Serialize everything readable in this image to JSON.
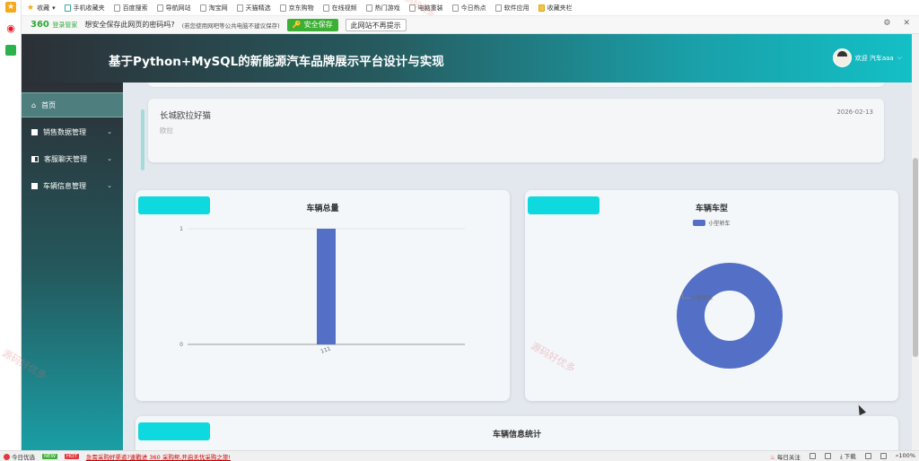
{
  "browser": {
    "bookmarks": [
      {
        "label": "收藏",
        "icon": "star-icon"
      },
      {
        "label": "手机收藏夹",
        "icon": "phone-icon"
      },
      {
        "label": "百度搜索",
        "icon": "page-icon"
      },
      {
        "label": "导航网站",
        "icon": "page-icon"
      },
      {
        "label": "淘宝网",
        "icon": "page-icon"
      },
      {
        "label": "天猫精选",
        "icon": "page-icon"
      },
      {
        "label": "京东购物",
        "icon": "page-icon"
      },
      {
        "label": "在线视频",
        "icon": "page-icon"
      },
      {
        "label": "热门游戏",
        "icon": "page-icon"
      },
      {
        "label": "电脑重装",
        "icon": "page-icon"
      },
      {
        "label": "今日热点",
        "icon": "page-icon"
      },
      {
        "label": "软件应用",
        "icon": "page-icon"
      },
      {
        "label": "收藏夹栏",
        "icon": "folder-icon"
      }
    ],
    "password_bar": {
      "brand": "360",
      "brand_sub": "登录管家",
      "question": "想安全保存此网页的密码吗?",
      "hint": "(若您使用网吧等公共电脑不建议保存)",
      "save_label": "安全保存",
      "never_label": "此网站不再提示"
    },
    "status_bar": {
      "left_label": "今日优选",
      "badge_new": "NEW",
      "badge_hot": "HOT",
      "promo": "急需采购好渠道?速戳进 360 采购帮,开启无忧采购之旅!",
      "right_items": [
        "每日关注",
        "下载",
        "100%"
      ]
    }
  },
  "app": {
    "title": "基于Python+MySQL的新能源汽车品牌展示平台设计与实现",
    "user_greeting": "欢迎 汽车aaa",
    "sidebar": [
      {
        "label": "首页",
        "icon": "home-icon",
        "active": true
      },
      {
        "label": "销售数据管理",
        "icon": "grid-icon"
      },
      {
        "label": "客服聊天管理",
        "icon": "chat-icon"
      },
      {
        "label": "车辆信息管理",
        "icon": "book-icon"
      }
    ]
  },
  "news": {
    "title": "长城欧拉好猫",
    "subtitle": "欧拉",
    "date": "2026-02-13"
  },
  "cards": {
    "total": {
      "title": "车辆总量"
    },
    "type": {
      "title": "车辆车型"
    },
    "stats": {
      "title": "车辆信息统计"
    }
  },
  "watermark": "源码好优多",
  "chart_data": [
    {
      "type": "bar",
      "title": "车辆总量",
      "categories": [
        "111"
      ],
      "values": [
        1
      ],
      "ylim": [
        0,
        1
      ],
      "yticks": [
        0,
        1
      ],
      "color": "#5470c6"
    },
    {
      "type": "pie",
      "title": "车辆车型",
      "donut": true,
      "legend": "top",
      "slices": [
        {
          "label": "小型轿车",
          "value": 1
        }
      ],
      "color": "#5470c6"
    }
  ]
}
